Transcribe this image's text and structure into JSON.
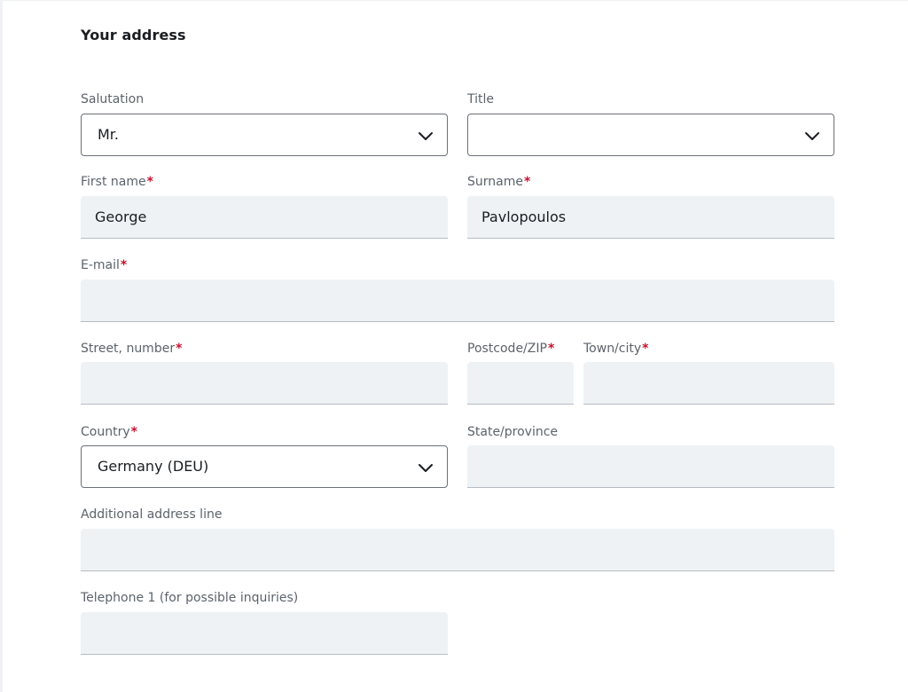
{
  "section": {
    "title": "Your address"
  },
  "labels": {
    "salutation": "Salutation",
    "title": "Title",
    "first_name": "First name",
    "surname": "Surname",
    "email": "E-mail",
    "street": "Street, number",
    "postcode": "Postcode/ZIP",
    "town": "Town/city",
    "country": "Country",
    "state": "State/province",
    "additional": "Additional address line",
    "telephone": "Telephone 1 (for possible inquiries)"
  },
  "required_marker": "*",
  "values": {
    "salutation": "Mr.",
    "title": "",
    "first_name": "George",
    "surname": "Pavlopoulos",
    "email": "",
    "street": "",
    "postcode": "",
    "town": "",
    "country": "Germany (DEU)",
    "state": "",
    "additional": "",
    "telephone": ""
  },
  "icons": {
    "dropdown": "chevron-down-icon"
  },
  "colors": {
    "required": "#c8102e",
    "field_bg": "#eff2f5",
    "label": "#5c636b"
  }
}
